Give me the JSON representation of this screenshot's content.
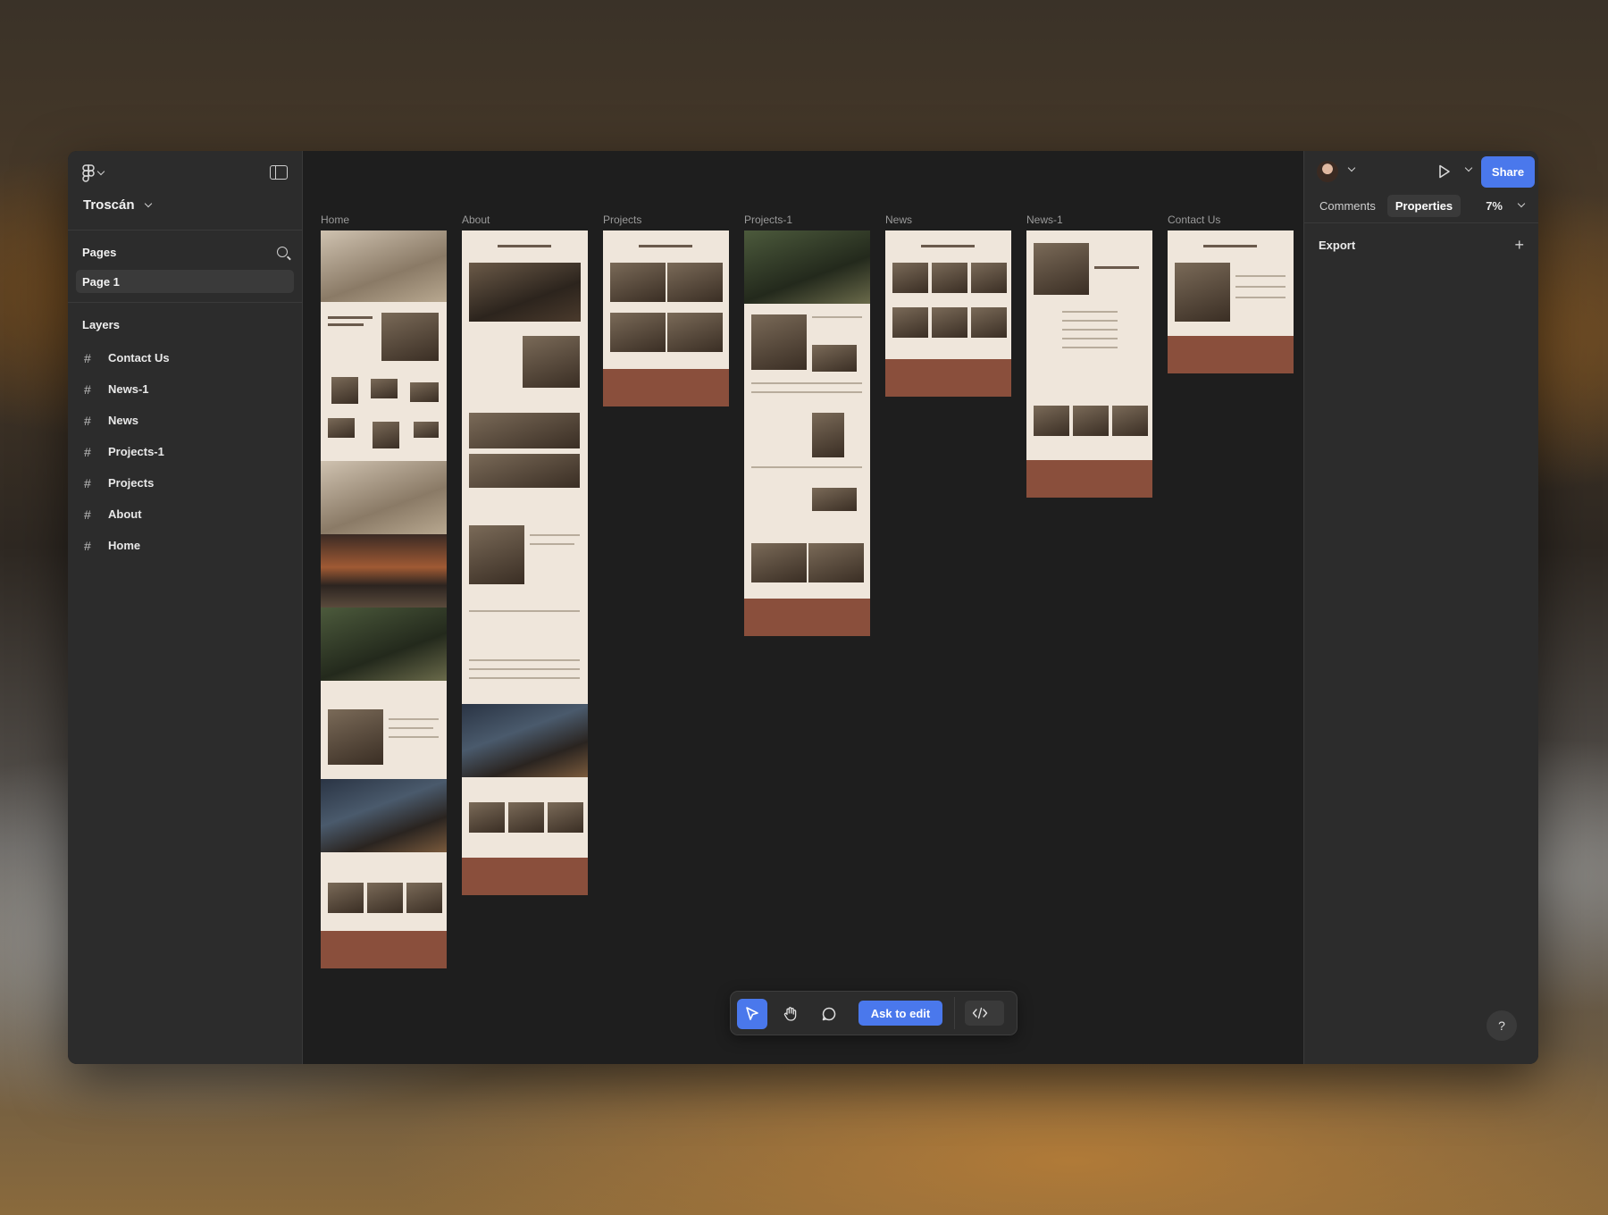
{
  "app": {
    "project_name": "Troscán"
  },
  "left_panel": {
    "pages_heading": "Pages",
    "pages": [
      {
        "label": "Page 1"
      }
    ],
    "layers_heading": "Layers",
    "layers": [
      {
        "label": "Contact Us"
      },
      {
        "label": "News-1"
      },
      {
        "label": "News"
      },
      {
        "label": "Projects-1"
      },
      {
        "label": "Projects"
      },
      {
        "label": "About"
      },
      {
        "label": "Home"
      }
    ]
  },
  "right_panel": {
    "share_label": "Share",
    "tabs": [
      {
        "label": "Comments"
      },
      {
        "label": "Properties"
      }
    ],
    "active_tab": "Properties",
    "zoom": "7%",
    "export_label": "Export",
    "help_label": "?"
  },
  "canvas": {
    "frames": [
      {
        "label": "Home"
      },
      {
        "label": "About"
      },
      {
        "label": "Projects"
      },
      {
        "label": "Projects-1"
      },
      {
        "label": "News"
      },
      {
        "label": "News-1"
      },
      {
        "label": "Contact Us"
      }
    ]
  },
  "toolbar": {
    "ask_label": "Ask to edit"
  },
  "colors": {
    "accent": "#4a78ec",
    "frame_background": "#efe6db",
    "frame_footer": "#8a4f3c"
  },
  "icons": [
    "figma-menu-icon",
    "sidebar-toggle-icon",
    "search-icon",
    "frame-hash-icon",
    "avatar",
    "play-icon",
    "plus-icon",
    "move-tool-icon",
    "hand-tool-icon",
    "comment-tool-icon",
    "code-icon",
    "help-icon"
  ]
}
